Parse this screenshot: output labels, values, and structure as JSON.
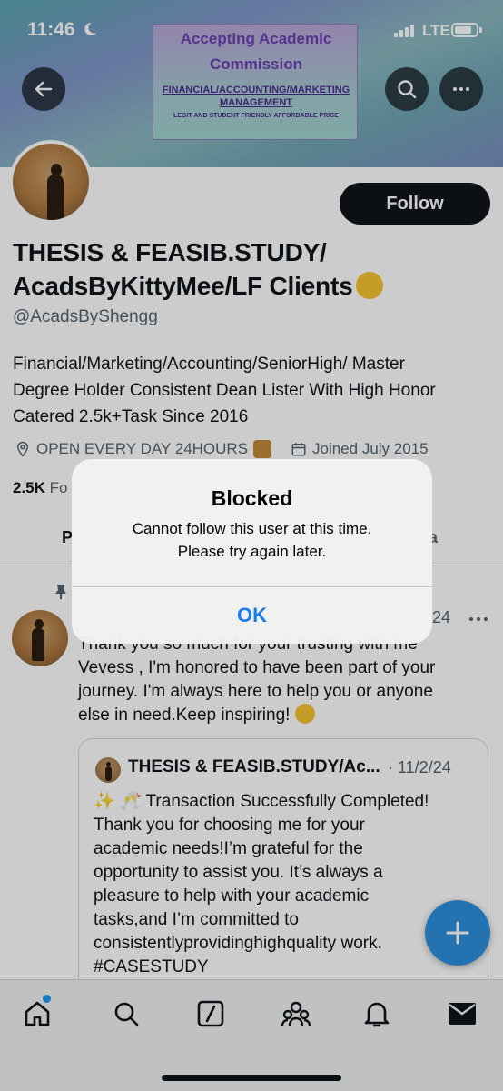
{
  "status_bar": {
    "time": "11:46",
    "network": "LTE"
  },
  "banner": {
    "line1": "Accepting Academic",
    "line2": "Commission",
    "line3": "FINANCIAL/ACCOUNTING/MARKETING",
    "line4": "MANAGEMENT",
    "line5": "LEGIT AND STUDENT FRIENDLY AFFORDABLE PRICE"
  },
  "profile": {
    "follow_label": "Follow",
    "name_line1": "THESIS & FEASIB.STUDY/",
    "name_line2": "AcadsByKittyMee/LF Clients",
    "handle": "@AcadsByShengg",
    "bio_line1": "Financial/Marketing/Accounting/SeniorHigh/ Master",
    "bio_line2": "Degree Holder Consistent Dean Lister With High Honor",
    "bio_line3": "Catered 2.5k+Task Since 2016",
    "location": "OPEN EVERY DAY 24HOURS",
    "joined": "Joined July 2015",
    "followers_count": "2.5K",
    "followers_fragment": "Fo"
  },
  "tabs": {
    "posts_fragment": "P",
    "media_fragment": "a"
  },
  "tweet": {
    "date_fragment": "24",
    "text_line1": "Thank you so much for your trusting with me",
    "text_line2": "Vevess , I'm honored to have been part of your",
    "text_line3": "journey. I'm always here to help you or anyone",
    "text_line4": "else in need.Keep inspiring!",
    "quote": {
      "name": "THESIS & FEASIB.STUDY/Ac...",
      "date": "· 11/2/24",
      "line1": "Transaction Successfully Completed!",
      "line2": "Thank you for choosing me for your",
      "line3": "academic needs!I’m grateful for the",
      "line4": "opportunity to assist you. It’s always a",
      "line5": "pleasure to help with your academic",
      "line6": "tasks,and I’m committed to",
      "line7": "consistentlyprovidinghighquality work.",
      "line8": "#CASESTUDY"
    }
  },
  "alert": {
    "title": "Blocked",
    "message_line1": "Cannot follow this user at this time.",
    "message_line2": "Please try again later.",
    "ok_label": "OK"
  },
  "colors": {
    "accent": "#1d9bf0",
    "fab": "#2f8fde",
    "alert_button": "#1a7cf0"
  },
  "icons": [
    "back-icon",
    "search-icon",
    "more-icon",
    "location-icon",
    "calendar-icon",
    "pin-icon",
    "home-icon",
    "explore-icon",
    "grok-icon",
    "communities-icon",
    "notifications-icon",
    "messages-icon",
    "compose-icon"
  ]
}
